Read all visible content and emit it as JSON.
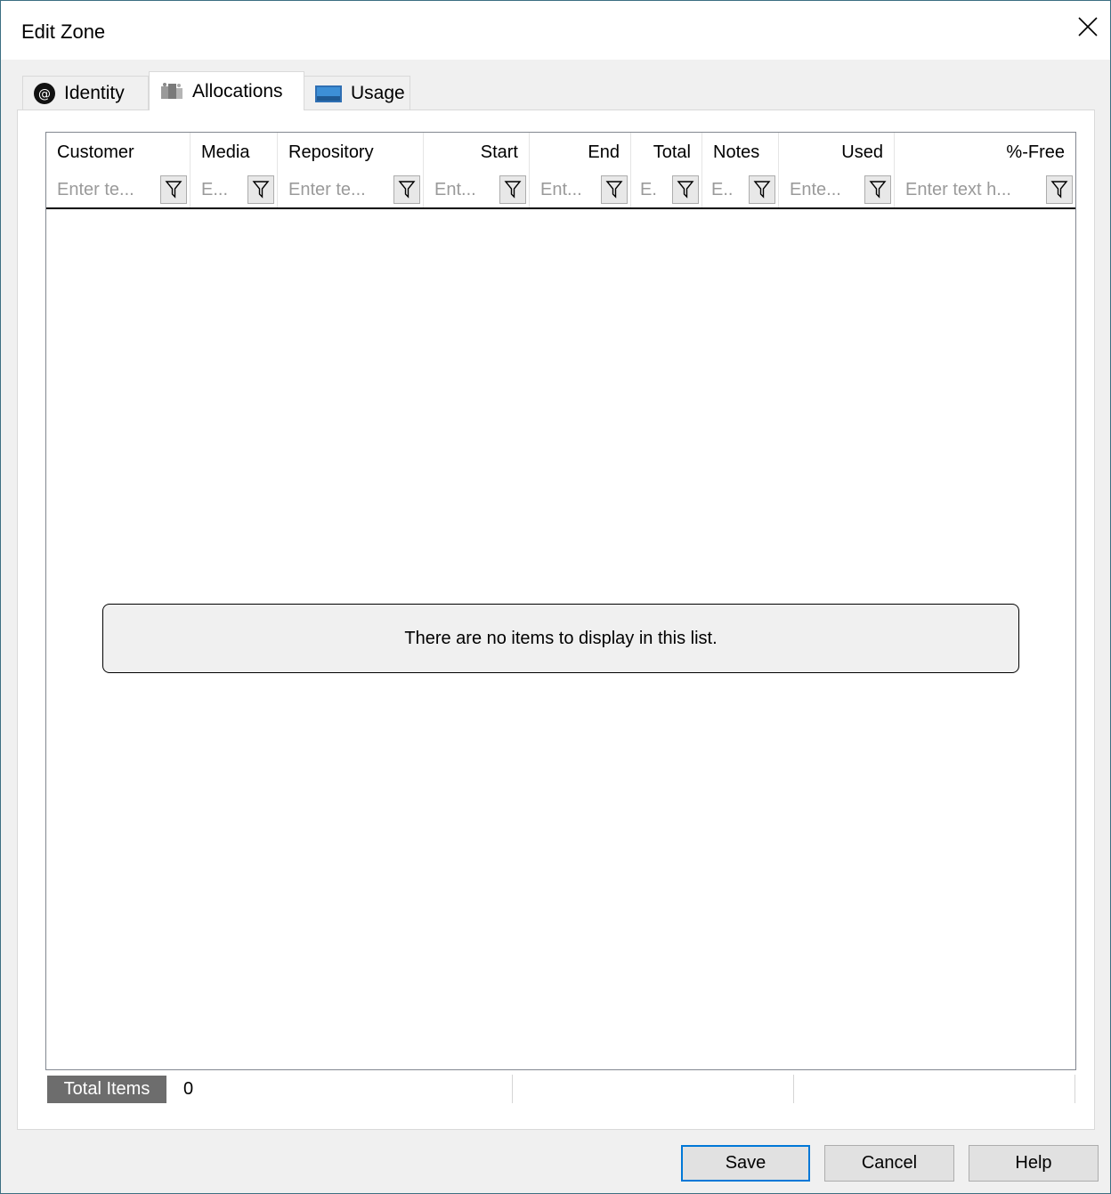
{
  "window": {
    "title": "Edit Zone"
  },
  "tabs": [
    {
      "label": "Identity",
      "icon": "at-sign-icon"
    },
    {
      "label": "Allocations",
      "icon": "allocations-icon",
      "active": true
    },
    {
      "label": "Usage",
      "icon": "usage-icon"
    }
  ],
  "grid": {
    "columns": [
      {
        "header": "Customer",
        "placeholder": "Enter te..."
      },
      {
        "header": "Media",
        "placeholder": "E..."
      },
      {
        "header": "Repository",
        "placeholder": "Enter te..."
      },
      {
        "header": "Start",
        "placeholder": "Ent..."
      },
      {
        "header": "End",
        "placeholder": "Ent..."
      },
      {
        "header": "Total",
        "placeholder": "E."
      },
      {
        "header": "Notes",
        "placeholder": "E.."
      },
      {
        "header": "Used",
        "placeholder": "Ente..."
      },
      {
        "header": "%-Free",
        "placeholder": "Enter text h..."
      }
    ],
    "empty_message": "There are no items to display in this list."
  },
  "status": {
    "label": "Total Items",
    "count": "0"
  },
  "buttons": {
    "save": "Save",
    "cancel": "Cancel",
    "help": "Help"
  }
}
